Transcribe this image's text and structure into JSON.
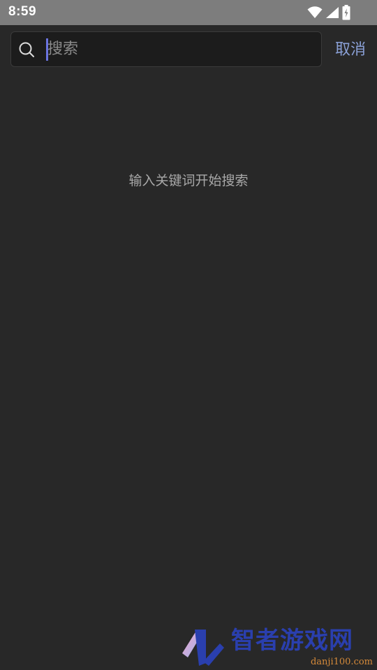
{
  "status_bar": {
    "time": "8:59",
    "icons": [
      "wifi-icon",
      "signal-icon",
      "battery-charging-icon"
    ]
  },
  "search": {
    "placeholder": "搜索",
    "value": "",
    "cancel_label": "取消"
  },
  "empty_state": {
    "hint": "输入关键词开始搜索"
  },
  "watermark": {
    "title": "智者游戏网",
    "subtitle": "danji100.com"
  },
  "colors": {
    "background": "#282828",
    "status_bar": "#7d7d7d",
    "search_box": "#1c1c1c",
    "accent_cancel": "#8aa0d6",
    "caret": "#6b74e0",
    "hint_text": "#a8a8a8"
  }
}
